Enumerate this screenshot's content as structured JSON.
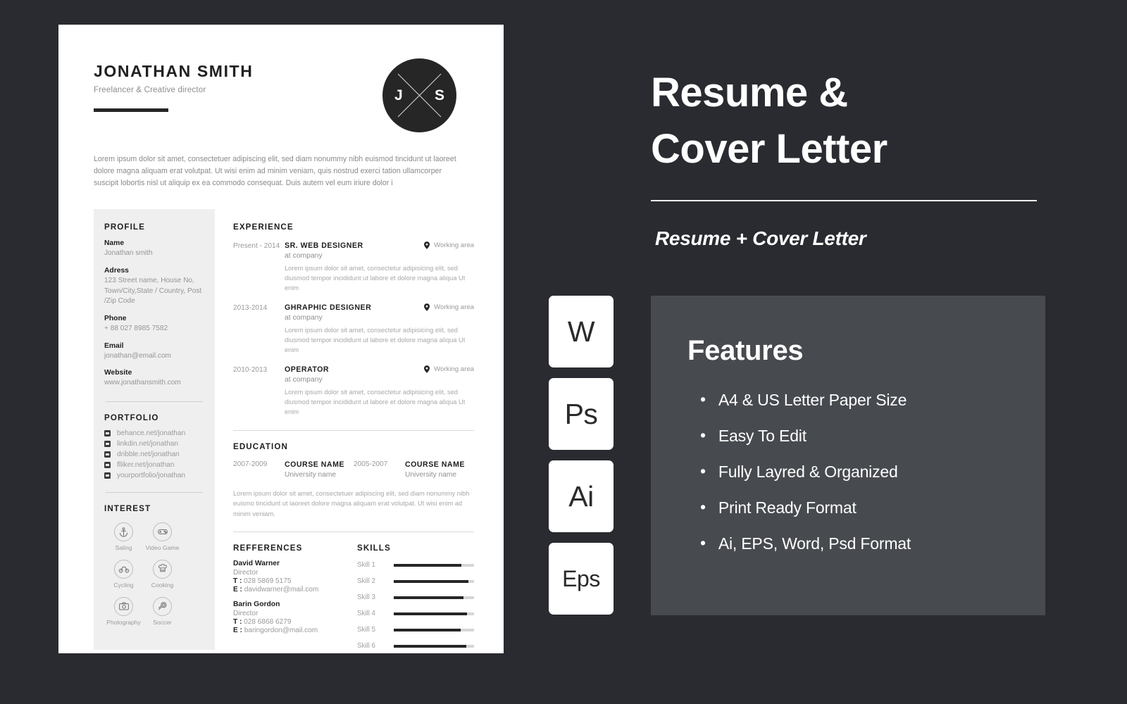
{
  "resume": {
    "header": {
      "name": "JONATHAN SMITH",
      "role": "Freelancer & Creative director",
      "logo_left": "J",
      "logo_right": "S",
      "summary": "Lorem ipsum dolor sit amet, consectetuer adipiscing elit, sed diam nonummy nibh euismod tincidunt ut laoreet dolore magna aliquam erat volutpat. Ut wisi enim ad minim veniam, quis nostrud exerci tation ullamcorper suscipit lobortis nisl ut aliquip ex ea commodo consequat. Duis autem vel eum iriure dolor i"
    },
    "profile": {
      "title": "PROFILE",
      "items": [
        {
          "label": "Name",
          "value": "Jonathan smith"
        },
        {
          "label": "Adress",
          "value": "123 Street name, House No, Town/City,State / Country, Post /Zip Code"
        },
        {
          "label": "Phone",
          "value": "+ 88 027 8985 7582"
        },
        {
          "label": "Email",
          "value": "jonathan@email.com"
        },
        {
          "label": "Website",
          "value": "www.jonathansmith.com"
        }
      ]
    },
    "portfolio": {
      "title": "PORTFOLIO",
      "links": [
        {
          "icon": "behance-icon",
          "text": "behance.net/jonathan"
        },
        {
          "icon": "linkedin-icon",
          "text": "linkdin.net/jonathan"
        },
        {
          "icon": "dribbble-icon",
          "text": "dribble.net/jonathan"
        },
        {
          "icon": "flickr-icon",
          "text": "flliker.net/jonathan"
        },
        {
          "icon": "portfolio-icon",
          "text": "yourportfolio/jonathan"
        }
      ]
    },
    "interest": {
      "title": "INTEREST",
      "items": [
        {
          "icon": "anchor-icon",
          "label": "Saling"
        },
        {
          "icon": "gamepad-icon",
          "label": "Video Game"
        },
        {
          "icon": "bicycle-icon",
          "label": "Cycling"
        },
        {
          "icon": "chef-hat-icon",
          "label": "Cooking"
        },
        {
          "icon": "camera-icon",
          "label": "Photography"
        },
        {
          "icon": "soccer-ball-icon",
          "label": "Soccer"
        }
      ]
    },
    "experience": {
      "title": "EXPERIENCE",
      "items": [
        {
          "date": "Present - 2014",
          "job_title": "SR. WEB DESIGNER",
          "company": "at company",
          "location": "Working area",
          "description": "Lorem ipsum dolor sit amet, consectetur adipisicing elit, sed diusmod tempor incididunt ut labore et dolore magna aliqua Ut enim"
        },
        {
          "date": "2013-2014",
          "job_title": "GHRAPHIC DESIGNER",
          "company": "at company",
          "location": "Working area",
          "description": "Lorem ipsum dolor sit amet, consectetur adipisicing elit, sed diusmod tempor incididunt ut labore et dolore magna aliqua Ut enim"
        },
        {
          "date": "2010-2013",
          "job_title": "OPERATOR",
          "company": "at company",
          "location": "Working area",
          "description": "Lorem ipsum dolor sit amet, consectetur adipisicing elit, sed diusmod tempor incididunt ut labore et dolore magna aliqua Ut enim"
        }
      ]
    },
    "education": {
      "title": "EDUCATION",
      "items": [
        {
          "date": "2007-2009",
          "course": "COURSE NAME",
          "university": "University name"
        },
        {
          "date": "2005-2007",
          "course": "COURSE NAME",
          "university": "University name"
        }
      ],
      "description": "Lorem ipsum dolor sit amet, consectetuer adipiscing elit, sed diam nonummy nibh euismo tincidunt ut laoreet dolore magna aliquam erat volutpat. Ut wisi enim ad minim veniam."
    },
    "references": {
      "title": "REFFERENCES",
      "items": [
        {
          "name": "David Warner",
          "role": "Director",
          "phone_label": "T :",
          "phone": "028 5869 5175",
          "email_label": "E :",
          "email": "davidwarner@mail.com"
        },
        {
          "name": "Barin Gordon",
          "role": "Director",
          "phone_label": "T :",
          "phone": "028 6868 6279",
          "email_label": "E :",
          "email": "baringordon@mail.com"
        }
      ]
    },
    "skills": {
      "title": "SKILLS",
      "items": [
        {
          "label": "Skill 1",
          "value": 84
        },
        {
          "label": "Skill 2",
          "value": 93
        },
        {
          "label": "Skill 3",
          "value": 87
        },
        {
          "label": "Skill 4",
          "value": 91
        },
        {
          "label": "Skill 5",
          "value": 83
        },
        {
          "label": "Skill 6",
          "value": 90
        }
      ]
    }
  },
  "promo": {
    "title_line1": "Resume &",
    "title_line2": "Cover  Letter",
    "subtitle": "Resume + Cover Letter",
    "badges": [
      {
        "label": "W",
        "name": "word-format-badge"
      },
      {
        "label": "Ps",
        "name": "photoshop-format-badge"
      },
      {
        "label": "Ai",
        "name": "illustrator-format-badge"
      },
      {
        "label": "Eps",
        "name": "eps-format-badge"
      }
    ],
    "features": {
      "title": "Features",
      "bullet": "•",
      "items": [
        "A4 & US Letter Paper Size",
        "Easy To Edit",
        "Fully Layred & Organized",
        "Print Ready Format",
        "Ai, EPS, Word, Psd Format"
      ]
    }
  },
  "colors": {
    "background": "#292b30",
    "panel": "#474a4f",
    "paper": "#ffffff",
    "sidebar": "#efefef",
    "ink": "#262626",
    "muted": "#9a9a9a"
  }
}
